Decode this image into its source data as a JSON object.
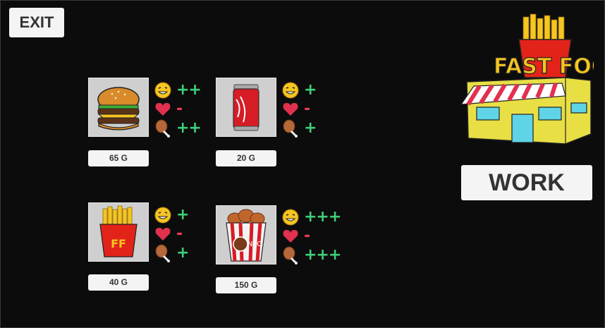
{
  "buttons": {
    "exit": "EXIT",
    "work": "WORK"
  },
  "shop_sign": "FAST FOOD",
  "items": [
    {
      "food": "burger",
      "price": "65 G",
      "happy": "++",
      "health": "-",
      "hunger": "++"
    },
    {
      "food": "cola",
      "price": "20 G",
      "happy": "+",
      "health": "-",
      "hunger": "+"
    },
    {
      "food": "fries",
      "price": "40 G",
      "happy": "+",
      "health": "-",
      "hunger": "+"
    },
    {
      "food": "chicken bucket",
      "price": "150 G",
      "happy": "+++",
      "health": "-",
      "hunger": "+++"
    }
  ],
  "stat_icons": [
    "smiley-icon",
    "heart-icon",
    "drumstick-icon"
  ],
  "colors": {
    "positive": "#3ecf7a",
    "negative": "#ee3b5a",
    "button": "#f4f4f4",
    "background": "#0c0c0c"
  }
}
